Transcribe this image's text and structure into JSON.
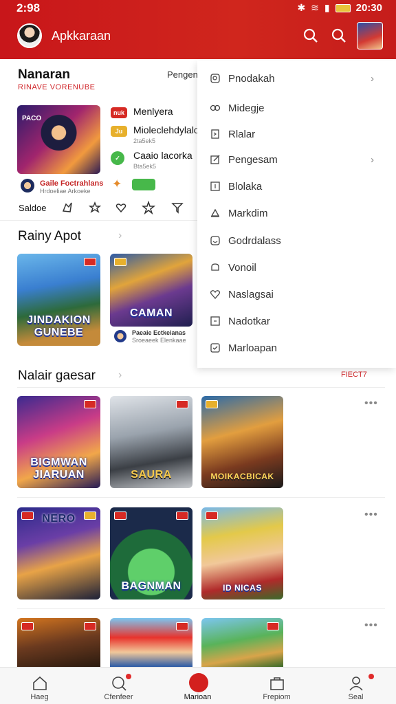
{
  "status_bar": {
    "time": "2:98",
    "right_time": "20:30"
  },
  "app_bar": {
    "title": "Apkkaraan"
  },
  "section1": {
    "title": "Nanaran",
    "subtitle": "RINAVE VORENUBE",
    "right_text": "Pengen",
    "feature": {
      "badge": "PACO",
      "meta_title": "Gaile Foctrahlans",
      "meta_sub": "Hrdoeliae Arkoeke"
    },
    "ranking": [
      {
        "badge": "nuk",
        "badge_color": "#d62a24",
        "name": "Menlyera",
        "meta": ""
      },
      {
        "badge": "Ju",
        "badge_color": "#e7b02c",
        "name": "Mioleclehdylalo",
        "meta": "2ta5ek5"
      },
      {
        "badge": "",
        "badge_color": "#47b84a",
        "name": "Caaio lacorka",
        "meta": "Bta5ek5"
      }
    ],
    "actions_label": "Saldoe"
  },
  "section2": {
    "title": "Rainy Apot",
    "cards": [
      {
        "label": "JINDAKION GUNEBE"
      },
      {
        "label": "CAMAN",
        "meta_title": "Paeaie Ectkeianas",
        "meta_sub": "Sroeaeek Elenkaae"
      }
    ]
  },
  "section3": {
    "title": "Nalair gaesar",
    "right_text": "FIECT7",
    "row1": [
      {
        "label": "BIGMWAN JIARUAN"
      },
      {
        "label": "SAURA"
      },
      {
        "label": "MOIKACBICAK"
      }
    ],
    "row2": [
      {
        "label": "NERO"
      },
      {
        "label": "BAGNMAN"
      },
      {
        "label": "ID NICAS"
      }
    ],
    "row3": [
      {
        "label": ""
      },
      {
        "label": ""
      },
      {
        "label": ""
      }
    ]
  },
  "menu": {
    "items": [
      {
        "label": "Pnodakah",
        "icon": "search-icon",
        "chevron": true
      },
      {
        "label": "Midegje",
        "icon": "link-icon",
        "chevron": false
      },
      {
        "label": "Rlalar",
        "icon": "document-icon",
        "chevron": false
      },
      {
        "label": "Pengesam",
        "icon": "edit-icon",
        "chevron": true
      },
      {
        "label": "Blolaka",
        "icon": "image-icon",
        "chevron": false
      },
      {
        "label": "Markdim",
        "icon": "bell-icon",
        "chevron": false
      },
      {
        "label": "Godrdalass",
        "icon": "smile-icon",
        "chevron": false
      },
      {
        "label": "Vonoil",
        "icon": "cloud-icon",
        "chevron": false
      },
      {
        "label": "Naslagsai",
        "icon": "heart-icon",
        "chevron": false
      },
      {
        "label": "Nadotkar",
        "icon": "flag-icon",
        "chevron": false
      },
      {
        "label": "Marloapan",
        "icon": "check-icon",
        "chevron": false
      }
    ]
  },
  "bottom_nav": [
    {
      "label": "Haeg",
      "icon": "home-icon"
    },
    {
      "label": "Cfenfeer",
      "icon": "search-icon"
    },
    {
      "label": "Marioan",
      "icon": "center-icon"
    },
    {
      "label": "Frepiom",
      "icon": "bag-icon"
    },
    {
      "label": "Seal",
      "icon": "profile-icon"
    }
  ],
  "colors": {
    "brand_red": "#d0261d",
    "accent_green": "#47b84a",
    "accent_yellow": "#e7b02c"
  }
}
